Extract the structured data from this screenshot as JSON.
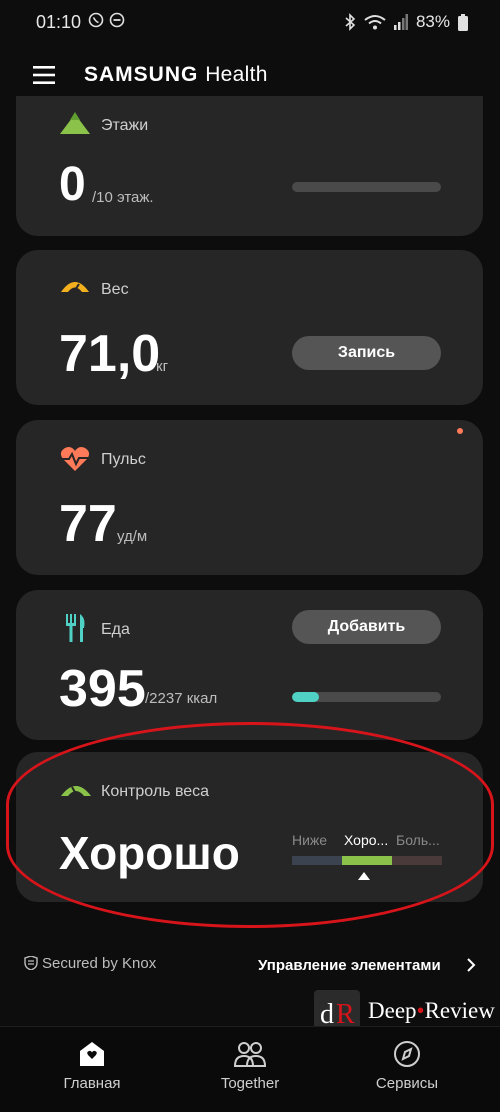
{
  "status_bar": {
    "time": "01:10",
    "battery": "83%"
  },
  "header": {
    "title_part1": "SAMSUNG",
    "title_part2": "Health"
  },
  "cards": {
    "floors": {
      "label": "Этажи",
      "value": "0",
      "unit": "/10 этаж.",
      "progress": 0
    },
    "weight": {
      "label": "Вес",
      "value": "71,0",
      "unit": "кг",
      "button": "Запись"
    },
    "pulse": {
      "label": "Пульс",
      "value": "77",
      "unit": "уд/м"
    },
    "food": {
      "label": "Еда",
      "value": "395",
      "unit": "/2237 ккал",
      "button": "Добавить",
      "progress": 0.18
    },
    "weight_control": {
      "label": "Контроль веса",
      "value": "Хорошо",
      "scale": [
        "Ниже",
        "Хоро...",
        "Боль..."
      ]
    }
  },
  "footer": {
    "secured": "Secured by Knox",
    "manage": "Управление элементами"
  },
  "watermark": {
    "text_deep": "Deep",
    "text_review": "Review"
  },
  "nav": {
    "home": "Главная",
    "together": "Together",
    "services": "Сервисы"
  },
  "colors": {
    "accent_green": "#8bc34a",
    "floor_progress": "#4a4a4a",
    "food_progress": "#4fd1c5",
    "heart": "#ff7a59",
    "weight_icon": "#f2b01e",
    "notify_dot": "#ff7a59",
    "ring": "#d8141b"
  }
}
